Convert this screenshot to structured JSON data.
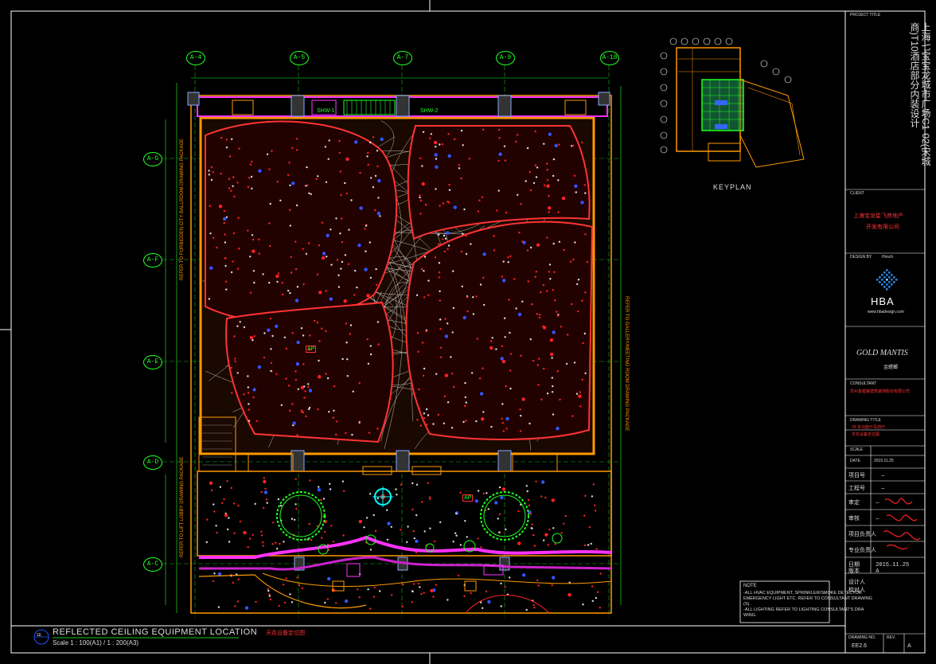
{
  "drawing": {
    "title": "REFLECTED CEILING EQUIPMENT LOCATION",
    "scale": "Scale 1 : 100(A1) / 1 : 200(A3)",
    "title_cn": "天花设备定位图",
    "sheet_id": "1E"
  },
  "grid": {
    "top": [
      "A-4",
      "A-5",
      "A-7",
      "A-9",
      "A-10"
    ],
    "left": [
      "A-G",
      "A-F",
      "A-E",
      "A-D",
      "A-C"
    ]
  },
  "room_tags": {
    "shw_1": "SHW-1",
    "shw_2": "SHW-2",
    "ap_1": "AP",
    "ap_2": "AP"
  },
  "side_notes": {
    "left_1": "REFER TO FORBIDDEN CITY BALLROOM DRAWING PACKAGE",
    "left_2": "REFER TO LIFT LOBBY DRAWING PACKAGE",
    "right_1": "REFER TO GALLERY/MEETING ROOM DRAWING PACKAGE"
  },
  "keyplan": {
    "label": "KEYPLAN"
  },
  "notes": {
    "heading": "NOTE",
    "lines": [
      "-ALL HVAC EQUIPMENT, SPRINKLER/SMOKE DETECTOR",
      "EMERGENCY LIGHT ETC. REFER TO CONSULTANT DRAWING",
      "(S).",
      "-ALL LIGHTING REFER TO LIGHTING CONSULTANT'S DRA",
      "WING."
    ]
  },
  "title_block": {
    "project_title_label": "PROJECT TITLE",
    "project_title": "上海七宝宝龙城市广场C1-02(宋城商)T10酒店部分内装设计",
    "client_label": "CLIENT",
    "client_lines": [
      "上海宝龙星飞房地产",
      "开发有限公司"
    ],
    "design_by_label": "DESIGN BY",
    "design_by": "Hirsch",
    "hba_logo": "HBA",
    "hba_sub": "www.hbadesign.com",
    "gm_logo": "GOLD MANTIS",
    "gm_sub": "金螳螂",
    "consultant_label": "CONSULTANT",
    "consultant_text": "苏州金螳螂建筑装饰股份有限公司",
    "drawing_title_label": "DRAWING TITLE",
    "drawing_title_lines": [
      "28 多功能厅及前厅",
      "天花设备定位图"
    ],
    "scale_label": "SCALE",
    "date_label": "DATE",
    "date_value": "2015.11.25",
    "rows": [
      {
        "label": "项目号",
        "value": "—"
      },
      {
        "label": "工程号",
        "value": "—"
      },
      {
        "label": "审定",
        "value": "—"
      },
      {
        "label": "审核",
        "value": "—"
      },
      {
        "label": "项目负责人",
        "value": "—"
      },
      {
        "label": "专业负责人",
        "value": "—"
      },
      {
        "label": "设计人",
        "value": "—"
      },
      {
        "label": "校对人",
        "value": "—"
      },
      {
        "label": "日期",
        "value": "2015.11.25"
      },
      {
        "label": "版本",
        "value": "A"
      }
    ],
    "drawing_no_label": "DRAWING NO.",
    "drawing_no": "EE2.6",
    "rev_label": "REV.",
    "rev_value": "A"
  },
  "colors": {
    "background": "#000000",
    "frame": "#ffffff",
    "grid": "#22ff22",
    "wall": "#ff9900",
    "magenta": "#ff33ff",
    "red_outline": "#ff3333",
    "cyan": "#00ffff",
    "blue": "#3355ff"
  }
}
